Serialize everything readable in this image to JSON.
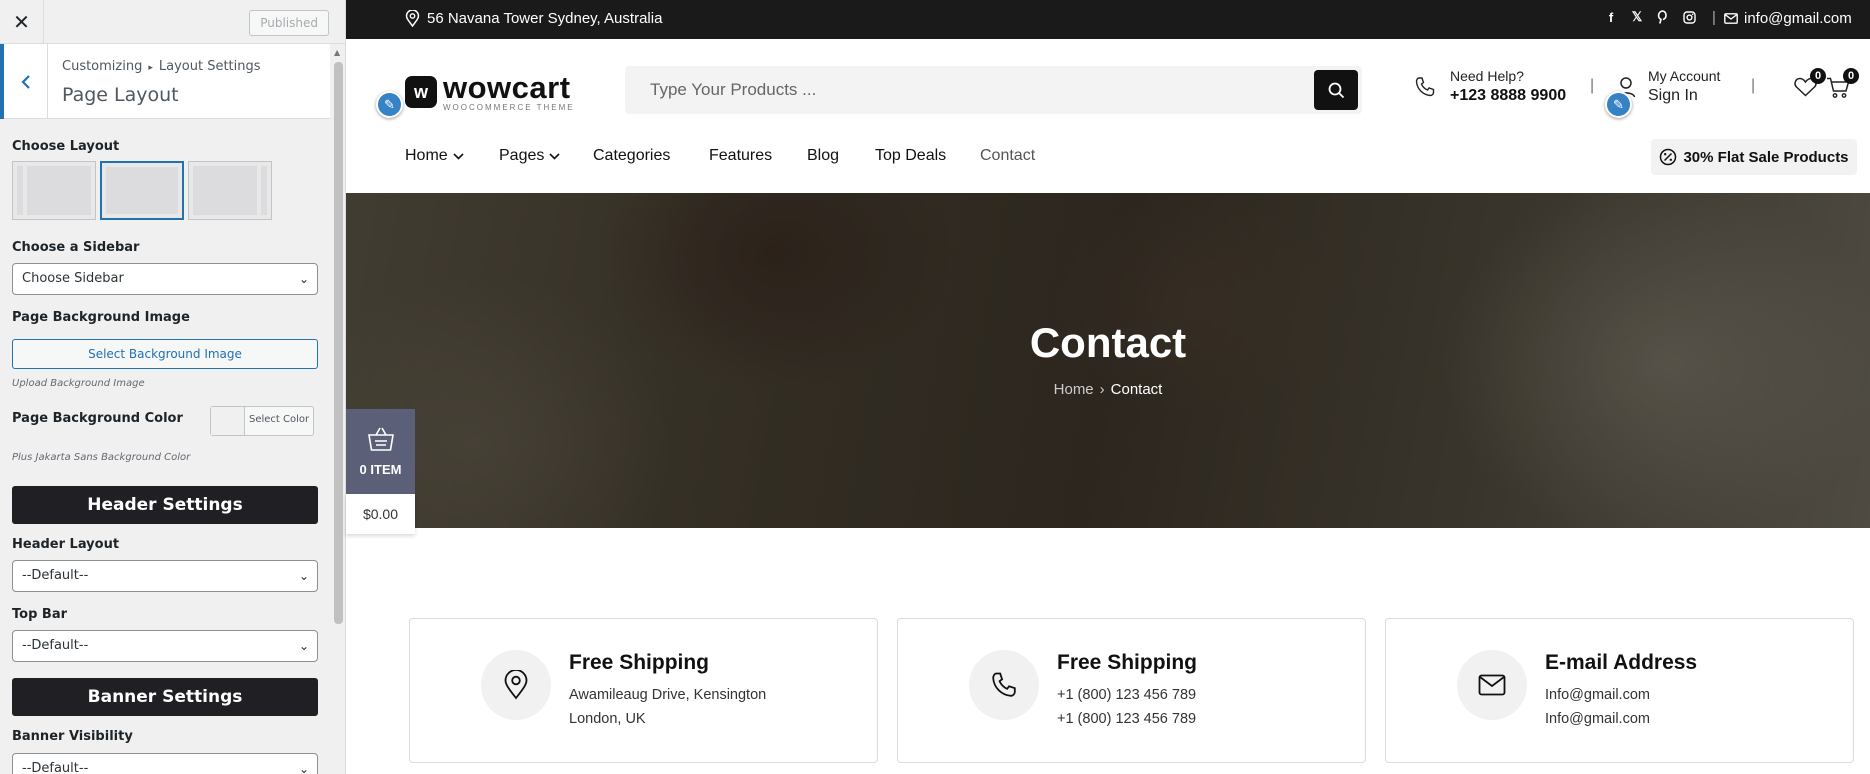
{
  "customizer": {
    "published_label": "Published",
    "breadcrumb_root": "Customizing",
    "breadcrumb_section": "Layout Settings",
    "panel_title": "Page Layout",
    "choose_layout_label": "Choose Layout",
    "choose_sidebar_label": "Choose a Sidebar",
    "sidebar_select_value": "Choose Sidebar",
    "bg_image_label": "Page Background Image",
    "bg_image_button": "Select Background Image",
    "bg_image_note": "Upload Background Image",
    "bg_color_label": "Page Background Color",
    "bg_color_button": "Select Color",
    "bg_color_note": "Plus Jakarta Sans Background Color",
    "header_settings_label": "Header Settings",
    "header_layout_label": "Header Layout",
    "header_layout_value": "--Default--",
    "top_bar_label": "Top Bar",
    "top_bar_value": "--Default--",
    "banner_settings_label": "Banner Settings",
    "banner_visibility_label": "Banner Visibility",
    "banner_visibility_value": "--Default--"
  },
  "topbar": {
    "address": "56 Navana Tower Sydney, Australia",
    "email": "info@gmail.com",
    "social_icons": [
      "facebook-icon",
      "x-icon",
      "pinterest-icon",
      "instagram-icon"
    ]
  },
  "header": {
    "logo_name": "wowcart",
    "logo_tagline": "WOOCOMMERCE THEME",
    "search_placeholder": "Type Your Products ...",
    "help_label": "Need Help?",
    "help_phone": "+123 8888 9900",
    "account_label": "My Account",
    "account_action": "Sign In",
    "wishlist_count": "0",
    "cart_count": "0"
  },
  "nav": {
    "items": [
      "Home",
      "Pages",
      "Categories",
      "Features",
      "Blog",
      "Top Deals",
      "Contact"
    ],
    "promo": "30% Flat Sale Products"
  },
  "hero": {
    "title": "Contact",
    "breadcrumb_home": "Home",
    "breadcrumb_current": "Contact"
  },
  "mini_cart": {
    "items": "0 ITEM",
    "total": "$0.00"
  },
  "cards": [
    {
      "title": "Free Shipping",
      "line1": "Awamileaug Drive, Kensington",
      "line2": "London, UK"
    },
    {
      "title": "Free Shipping",
      "line1": "+1 (800) 123 456 789",
      "line2": "+1 (800) 123 456 789"
    },
    {
      "title": "E-mail Address",
      "line1": "Info@gmail.com",
      "line2": "Info@gmail.com"
    }
  ],
  "colors": {
    "accent_blue": "#2271b1",
    "dark": "#1f1f24",
    "topbar": "#1a1a1a",
    "mini_cart": "#5b6078"
  }
}
